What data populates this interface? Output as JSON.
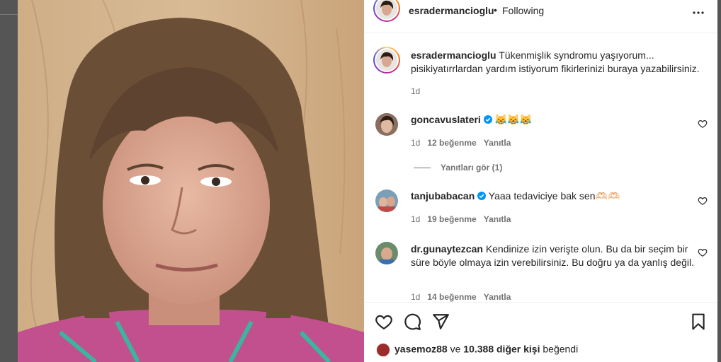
{
  "post": {
    "author": "esradermancioglu",
    "follow_status": "Following",
    "separator": "•",
    "caption_user": "esradermancioglu",
    "caption_text": "Tükenmişlik syndromu yaşıyorum... pisikiyatırrlardan yardım istiyorum fikirlerinizi buraya yazabilirsiniz.",
    "caption_time": "1d"
  },
  "comments": [
    {
      "user": "goncavuslateri",
      "verified": true,
      "text": "😹😹😹",
      "time": "1d",
      "likes": "12 beğenme",
      "reply": "Yanıtla"
    },
    {
      "user": "tanjubabacan",
      "verified": true,
      "text": "Yaaa tedaviciye bak sen🫶🏻🫶🏻",
      "time": "1d",
      "likes": "19 beğenme",
      "reply": "Yanıtla"
    },
    {
      "user": "dr.gunaytezcan",
      "verified": false,
      "text": "Kendinize izin verişte olun. Bu da bir seçim bir süre böyle olmaya izin verebilirsiniz. Bu doğru ya da yanlış değil.",
      "time": "1d",
      "likes": "14 beğenme",
      "reply": "Yanıtla"
    }
  ],
  "view_replies": "Yanıtları gör (1)",
  "likes_bar": {
    "first_liker": "yasemoz88",
    "connector": "ve",
    "count": "10.388 diğer kişi",
    "suffix": "beğendi"
  },
  "colors": {
    "verified": "#0095f6",
    "text": "#262626",
    "muted": "#737373"
  },
  "icons": [
    "more-options-icon",
    "heart-icon",
    "comment-icon",
    "share-icon",
    "save-icon",
    "verified-icon"
  ]
}
